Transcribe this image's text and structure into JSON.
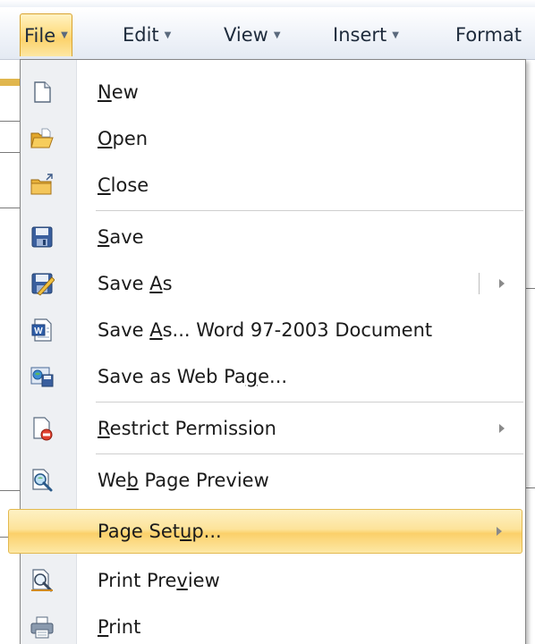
{
  "menubar": {
    "items": [
      {
        "label": "File",
        "arrow": "▼"
      },
      {
        "label": "Edit",
        "arrow": "▼"
      },
      {
        "label": "View",
        "arrow": "▼"
      },
      {
        "label": "Insert",
        "arrow": "▼"
      },
      {
        "label": "Format",
        "arrow": ""
      }
    ]
  },
  "file_menu": {
    "items": [
      {
        "pre": "",
        "ul": "N",
        "post": "ew",
        "icon": "new-document-icon"
      },
      {
        "pre": "",
        "ul": "O",
        "post": "pen",
        "icon": "open-folder-icon"
      },
      {
        "pre": "",
        "ul": "C",
        "post": "lose",
        "icon": "close-folder-icon"
      },
      {
        "pre": "",
        "ul": "S",
        "post": "ave",
        "icon": "save-disk-icon"
      },
      {
        "pre": "Save ",
        "ul": "A",
        "post": "s",
        "icon": "save-as-icon"
      },
      {
        "pre": "Save ",
        "ul": "A",
        "post": "s... Word 97-2003 Document",
        "icon": "word-document-icon"
      },
      {
        "pre": "Save as Web Pa",
        "ul": "g",
        "post": "e...",
        "icon": "web-page-icon"
      },
      {
        "pre": "",
        "ul": "R",
        "post": "estrict Permission",
        "icon": "restrict-permission-icon"
      },
      {
        "pre": "We",
        "ul": "b",
        "post": " Page Preview",
        "icon": "web-preview-icon"
      },
      {
        "pre": "Page Set",
        "ul": "u",
        "post": "p...",
        "icon": ""
      },
      {
        "pre": "Print Pre",
        "ul": "v",
        "post": "iew",
        "icon": "print-preview-icon"
      },
      {
        "pre": "",
        "ul": "P",
        "post": "rint",
        "icon": "printer-icon"
      }
    ]
  }
}
